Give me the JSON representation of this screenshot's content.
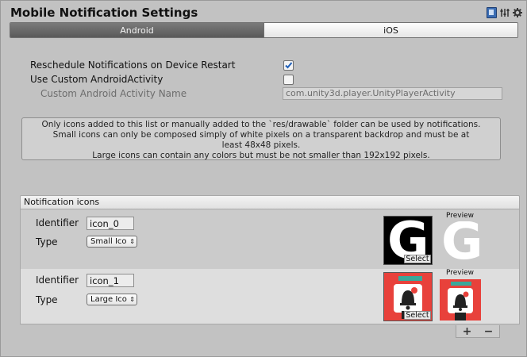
{
  "header": {
    "title": "Mobile Notification Settings",
    "icons": [
      "help-book-icon",
      "preset-sliders-icon",
      "gear-icon"
    ]
  },
  "tabs": [
    {
      "label": "Android",
      "active": true
    },
    {
      "label": "iOS",
      "active": false
    }
  ],
  "settings": {
    "reschedule_label": "Reschedule Notifications on Device Restart",
    "reschedule_checked": true,
    "custom_activity_label": "Use Custom AndroidActivity",
    "custom_activity_checked": false,
    "activity_name_label": "Custom Android Activity Name",
    "activity_name_value": "com.unity3d.player.UnityPlayerActivity"
  },
  "help_text": [
    "Only icons added to this list or manually added to the `res/drawable` folder can be used by notifications.",
    "Small icons can only be  composed simply of white pixels on a transparent backdrop and must be at",
    "least 48x48 pixels.",
    "Large icons can contain any colors but must be not smaller than 192x192 pixels."
  ],
  "icons_list": {
    "header": "Notification icons",
    "identifier_label": "Identifier",
    "type_label": "Type",
    "select_label": "Select",
    "preview_label": "Preview",
    "items": [
      {
        "identifier": "icon_0",
        "type": "Small Icon",
        "type_display": "Small Ico"
      },
      {
        "identifier": "icon_1",
        "type": "Large Icon",
        "type_display": "Large Ico"
      }
    ],
    "add_label": "+",
    "remove_label": "−"
  },
  "colors": {
    "background": "#c2c2c2",
    "active_tab": "#5e5e5e",
    "checkbox_check": "#1f5fb8",
    "large_icon_red": "#e8413b"
  }
}
